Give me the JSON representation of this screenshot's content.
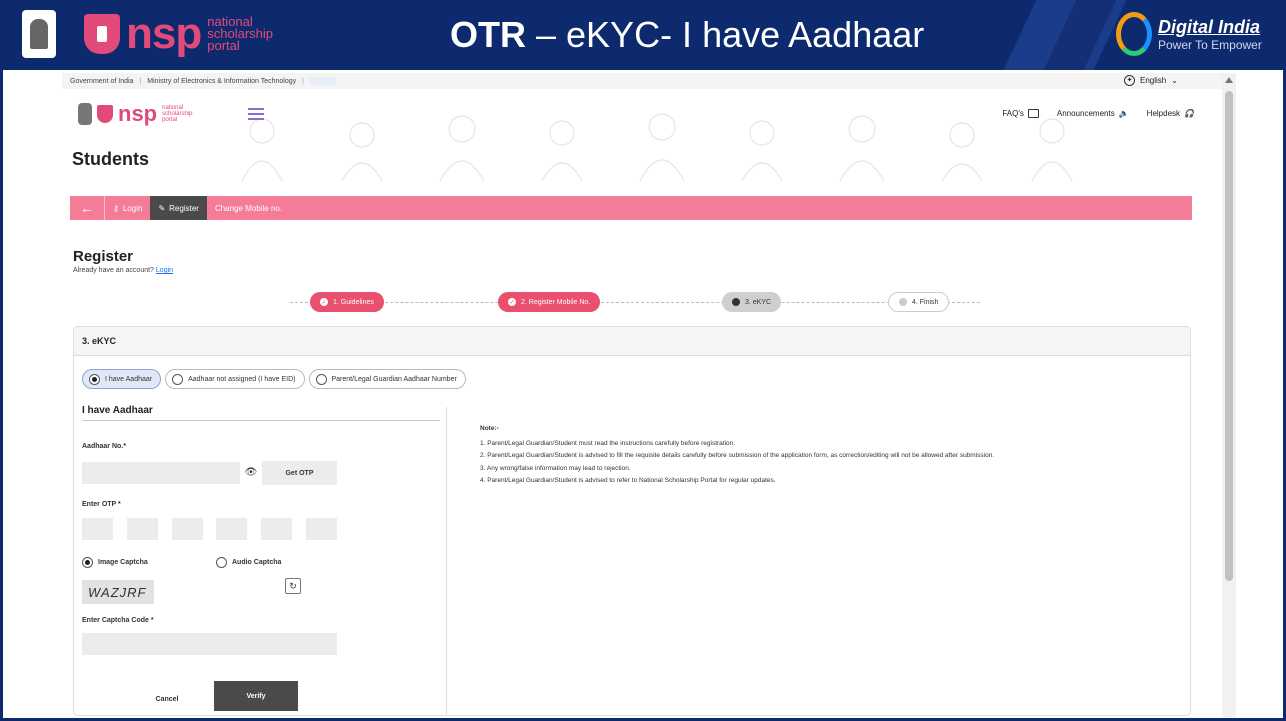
{
  "banner": {
    "logo_text": "nsp",
    "logo_sub1": "national",
    "logo_sub2": "scholarship",
    "logo_sub3": "portal",
    "title_bold": "OTR",
    "title_rest": " – eKYC- I have Aadhaar",
    "di_title": "Digital India",
    "di_sub": "Power To Empower"
  },
  "govbar": {
    "gov": "Government of India",
    "ministry": "Ministry of Electronics & Information Technology",
    "language": "English"
  },
  "header": {
    "logo_text": "nsp",
    "logo_sub1": "national",
    "logo_sub2": "scholarship",
    "logo_sub3": "portal",
    "faqs": "FAQ's",
    "announcements": "Announcements",
    "helpdesk": "Helpdesk",
    "page_title": "Students"
  },
  "nav": {
    "back": "←",
    "login": "Login",
    "register": "Register",
    "change_mobile": "Change Mobile no."
  },
  "register": {
    "title": "Register",
    "already": "Already have an account?",
    "login_link": "Login"
  },
  "steps": [
    {
      "label": "1. Guidelines",
      "state": "done"
    },
    {
      "label": "2. Register Mobile No.",
      "state": "done"
    },
    {
      "label": "3. eKYC",
      "state": "current"
    },
    {
      "label": "4. Finish",
      "state": "todo"
    }
  ],
  "ekyc": {
    "card_title": "3. eKYC",
    "options": [
      "I have Aadhaar",
      "Aadhaar not assigned (I have EID)",
      "Parent/Legal Guardian Aadhaar Number"
    ],
    "selected_option": "I have Aadhaar",
    "form_title": "I have Aadhaar",
    "aadhaar_label": "Aadhaar No.*",
    "aadhaar_value": "",
    "get_otp": "Get OTP",
    "otp_label": "Enter OTP *",
    "image_captcha": "Image Captcha",
    "audio_captcha": "Audio Captcha",
    "captcha_text": "WAZJRF",
    "captcha_label": "Enter Captcha Code *",
    "captcha_value": "",
    "cancel": "Cancel",
    "verify": "Verify"
  },
  "notes": {
    "title": "Note:-",
    "items": [
      "1. Parent/Legal Guardian/Student must read the instructions carefully before registration.",
      "2. Parent/Legal Guardian/Student is advised to fill the requisite details carefully before submission of the application form, as correction/editing will not be allowed after submission.",
      "3. Any wrong/false information may lead to rejection.",
      "4. Parent/Legal Guardian/Student is advised to refer to National Scholarship Portal for regular updates."
    ]
  },
  "colors": {
    "banner": "#0d2a6e",
    "accent_pink": "#f57c96",
    "step_done": "#e8506e",
    "active_tab": "#4a4a4a"
  }
}
